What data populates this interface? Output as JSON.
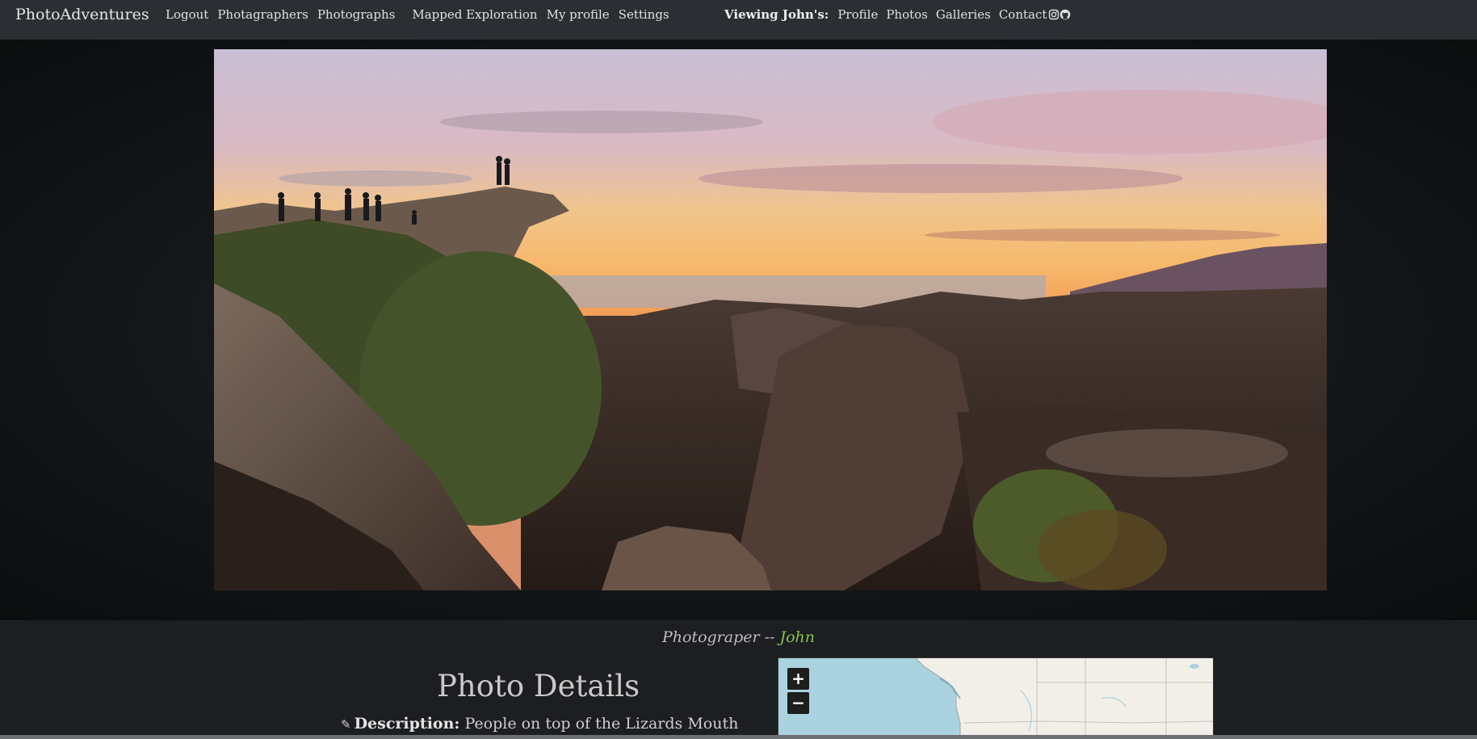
{
  "navbar": {
    "brand": "PhotoAdventures",
    "links": [
      "Logout",
      "Photagraphers",
      "Photographs",
      "Mapped Exploration",
      "My profile",
      "Settings"
    ],
    "viewing_label": "Viewing John's:",
    "viewing_links": [
      "Profile",
      "Photos",
      "Galleries",
      "Contact"
    ],
    "icons": [
      "instagram-icon",
      "github-icon"
    ]
  },
  "hero": {
    "image_subject": "sunset over rocky mountain landscape with hikers"
  },
  "credit": {
    "prefix": "Photograper -- ",
    "photographer": "John"
  },
  "details": {
    "title": "Photo Details",
    "description_label": "Description:",
    "description_value": "People on top of the Lizards Mouth",
    "icon": "pencil-icon"
  },
  "map": {
    "zoom_in": "+",
    "zoom_out": "−"
  },
  "colors": {
    "navbar_bg": "#2b2f33",
    "page_bg": "#1c1e21",
    "accent_green": "#8bbf4f"
  }
}
